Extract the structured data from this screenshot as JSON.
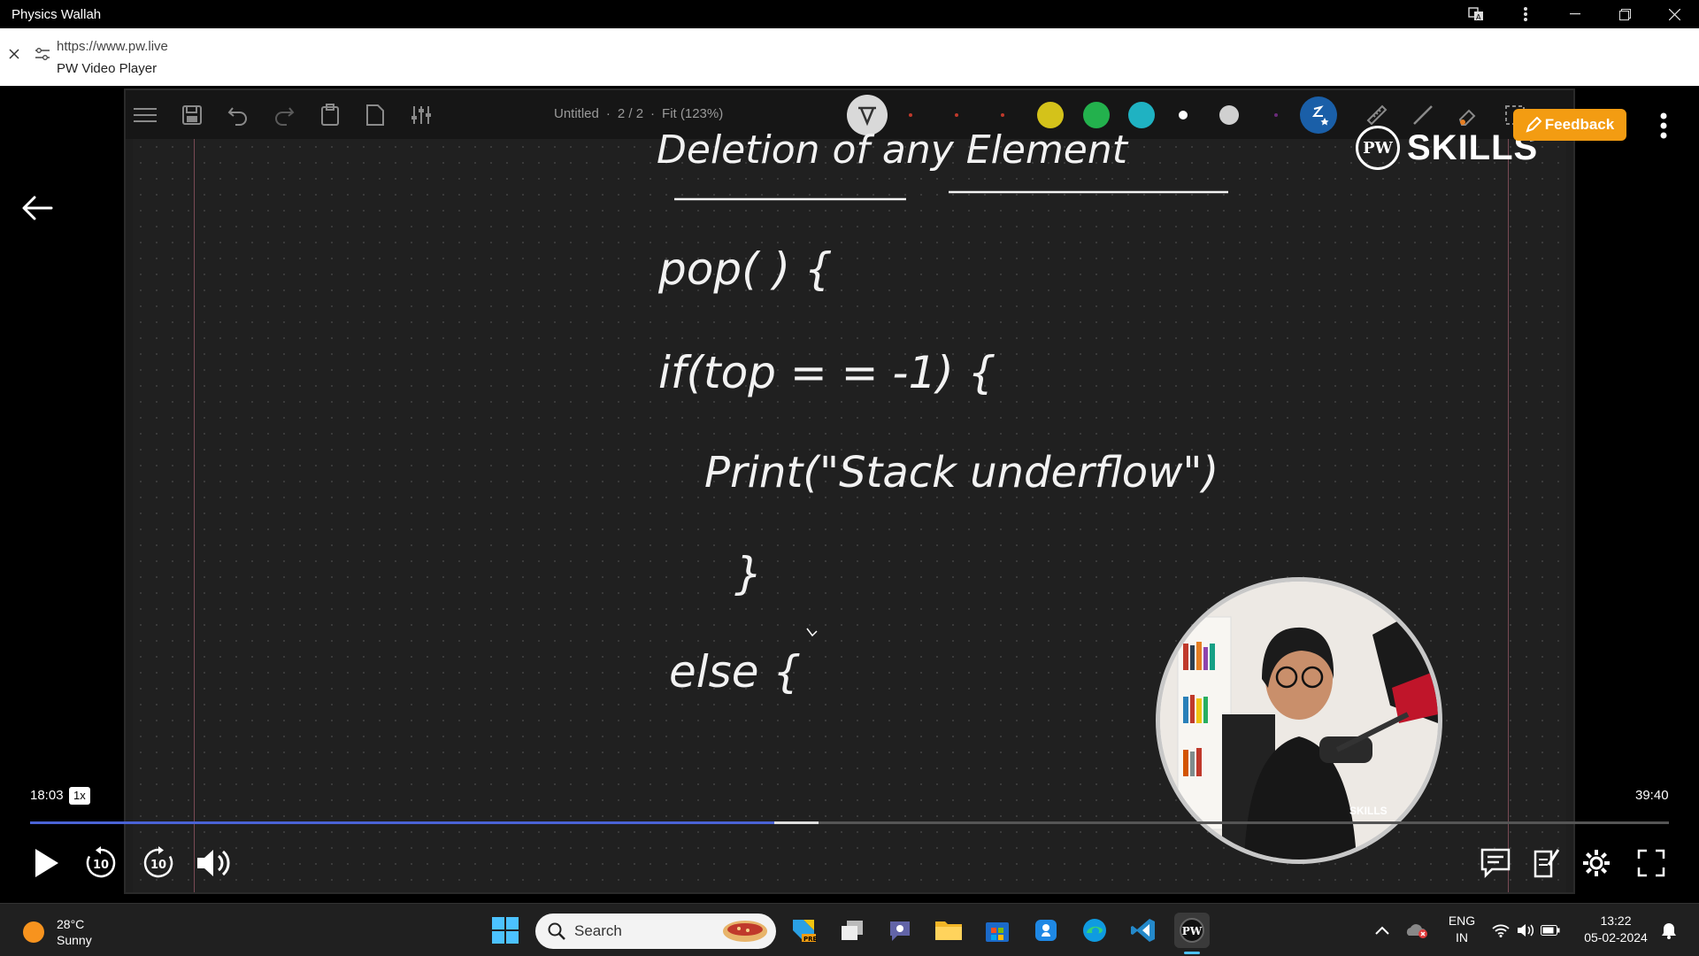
{
  "window": {
    "title": "Physics Wallah"
  },
  "urlbar": {
    "url": "https://www.pw.live",
    "page_title": "PW Video Player"
  },
  "whiteboard": {
    "doc_title": "Untitled",
    "page_indicator": "2 / 2",
    "zoom": "Fit (123%)",
    "colors": [
      "#d4c21a",
      "#23b14d",
      "#1fb2c2",
      "#ffffff",
      "#d0d0d0"
    ],
    "handwriting": {
      "heading": "Deletion of any Element",
      "line1": "pop( ) {",
      "line2": "if(top = = -1) {",
      "line3": "Print(\"Stack underflow\")",
      "line4": "}",
      "line5": "else {"
    }
  },
  "logo": {
    "text": "SKILLS",
    "badge": "PW"
  },
  "webcam": {
    "label": "SKILLS"
  },
  "feedback_label": "Feedback",
  "player": {
    "current_time": "18:03",
    "speed": "1x",
    "total_time": "39:40",
    "progress_fraction": 0.454,
    "buffer_fraction": 0.481,
    "rewind_label": "10",
    "forward_label": "10",
    "accent": "#4a63d6"
  },
  "taskbar": {
    "weather_temp": "28°C",
    "weather_text": "Sunny",
    "search_label": "Search",
    "language": "ENG",
    "region": "IN",
    "time": "13:22",
    "date": "05-02-2024"
  }
}
